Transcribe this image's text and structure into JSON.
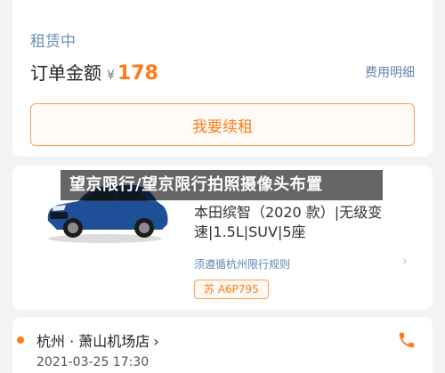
{
  "order": {
    "status": "租赁中",
    "price_label": "订单金额",
    "currency": "¥",
    "price": "178",
    "fee_detail_link": "费用明细",
    "renew_button": "我要续租"
  },
  "vehicle": {
    "title": "本田缤智（2020 款）|无级变速|1.5L|SUV|5座",
    "rule_link": "须遵循杭州限行规则",
    "plate": "苏 A6P795"
  },
  "trip": {
    "route": "杭州 · 萧山机场店",
    "time": "2021-03-25 17:30"
  },
  "overlay": {
    "headline": "望京限行/望京限行拍照摄像头布置"
  },
  "colors": {
    "accent": "#ff7a1a",
    "link": "#5f86b5",
    "status": "#6a8fb8"
  }
}
